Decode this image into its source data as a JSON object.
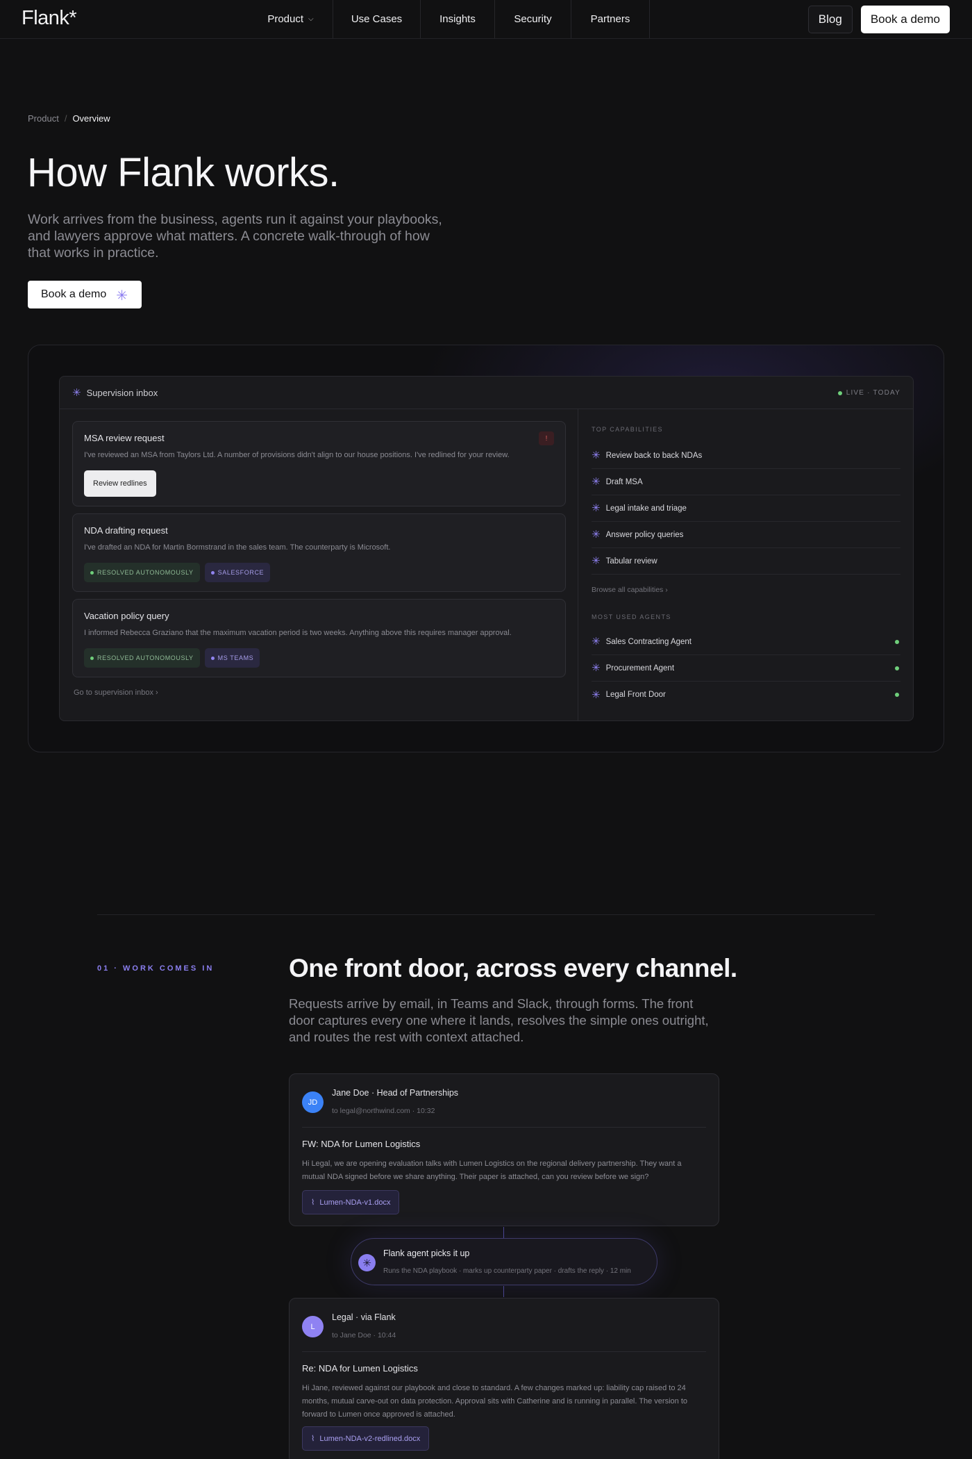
{
  "nav": {
    "logo": "Flank*",
    "links": [
      "Product",
      "Use Cases",
      "Insights",
      "Security",
      "Partners"
    ],
    "blog": "Blog",
    "book_demo": "Book a demo"
  },
  "hero": {
    "breadcrumb": [
      "Product",
      "Overview"
    ],
    "title": "How Flank works.",
    "subtitle": "Work arrives from the business, agents run it against your playbooks, and lawyers approve what matters. A concrete walk-through of how that works in practice.",
    "cta": "Book a demo"
  },
  "inbox": {
    "title": "Supervision inbox",
    "live": "LIVE · TODAY",
    "cards": [
      {
        "title": "MSA review request",
        "body": "I've reviewed an MSA from Taylors Ltd. A number of provisions didn't align to our house positions. I've redlined for your review.",
        "flag": "!",
        "button": "Review redlines"
      },
      {
        "title": "NDA drafting request",
        "body": "I've drafted an NDA for Martin Bormstrand in the sales team. The counterparty is Microsoft.",
        "tags": [
          "RESOLVED AUTONOMOUSLY",
          "SALESFORCE"
        ]
      },
      {
        "title": "Vacation policy query",
        "body": "I informed Rebecca Graziano that the maximum vacation period is two weeks. Anything above this requires manager approval.",
        "tags": [
          "RESOLVED AUTONOMOUSLY",
          "MS TEAMS"
        ]
      }
    ],
    "go_link": "Go to supervision inbox ›",
    "capabilities_label": "TOP CAPABILITIES",
    "capabilities": [
      "Review back to back NDAs",
      "Draft MSA",
      "Legal intake and triage",
      "Answer policy queries",
      "Tabular review"
    ],
    "browse": "Browse all capabilities ›",
    "agents_label": "MOST USED AGENTS",
    "agents": [
      "Sales Contracting Agent",
      "Procurement Agent",
      "Legal Front Door"
    ]
  },
  "section1": {
    "eyebrow": "01 · WORK COMES IN",
    "title": "One front door, across every channel.",
    "subtitle": "Requests arrive by email, in Teams and Slack, through forms. The front door captures every one where it lands, resolves the simple ones outright, and routes the rest with context attached.",
    "email_in": {
      "avatar": "JD",
      "from": "Jane Doe · Head of Partnerships",
      "to": "to legal@northwind.com · 10:32",
      "subject": "FW: NDA for Lumen Logistics",
      "body": "Hi Legal, we are opening evaluation talks with Lumen Logistics on the regional delivery partnership. They want a mutual NDA signed before we share anything. Their paper is attached, can you review before we sign?",
      "attachment": "Lumen-NDA-v1.docx"
    },
    "agent": {
      "title": "Flank agent picks it up",
      "sub": "Runs the NDA playbook · marks up counterparty paper · drafts the reply · 12 min"
    },
    "email_out": {
      "avatar": "L",
      "from": "Legal · via Flank",
      "to": "to Jane Doe · 10:44",
      "subject": "Re: NDA for Lumen Logistics",
      "body": "Hi Jane, reviewed against our playbook and close to standard. A few changes marked up: liability cap raised to 24 months, mutual carve-out on data protection. Approval sits with Catherine and is running in parallel. The version to forward to Lumen once approved is attached.",
      "attachment": "Lumen-NDA-v2-redlined.docx"
    }
  },
  "colors": {
    "accent": "#8b7ff0",
    "background": "#111112",
    "status_green": "#6fcf7b",
    "avatar_blue": "#3b82f6",
    "avatar_purple": "#8f82f2"
  }
}
